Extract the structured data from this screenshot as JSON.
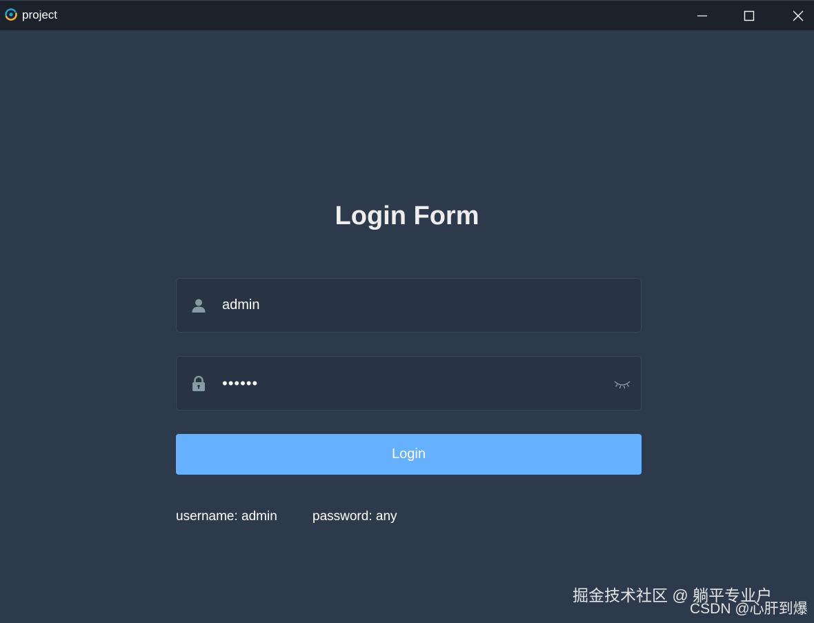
{
  "window": {
    "title": "project",
    "controls": [
      "minimize",
      "maximize",
      "close"
    ]
  },
  "form": {
    "title": "Login Form",
    "username": {
      "value": "admin",
      "icon": "user-icon"
    },
    "password": {
      "value": "••••••",
      "icon": "lock-icon",
      "toggle_icon": "eye-closed-icon"
    },
    "login_label": "Login"
  },
  "tips": {
    "username": "username: admin",
    "password": "password: any"
  },
  "watermark": {
    "line1": "掘金技术社区 @ 躺平专业户",
    "line2": "CSDN @心肝到爆"
  },
  "colors": {
    "background": "#2d3a4b",
    "titlebar": "#1c222c",
    "input_bg": "#283443",
    "button": "#66b1ff",
    "icon": "#889aa4"
  }
}
